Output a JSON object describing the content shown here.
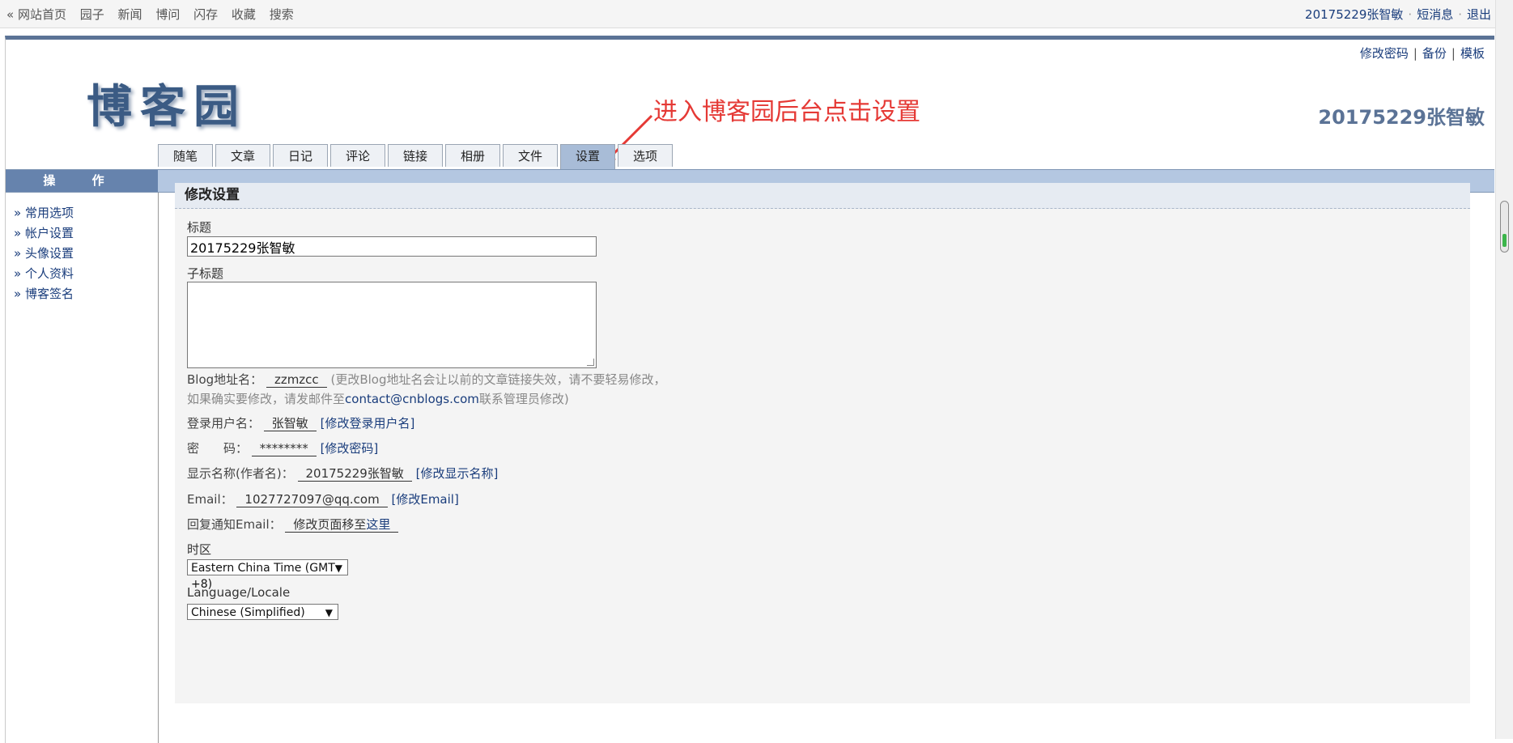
{
  "topnav": {
    "items": [
      "« 网站首页",
      "园子",
      "新闻",
      "博问",
      "闪存",
      "收藏",
      "搜索"
    ],
    "user": "20175229张智敏",
    "messages": "短消息",
    "logout": "退出"
  },
  "header": {
    "links": [
      "修改密码",
      "备份",
      "模板"
    ],
    "logo_text": "博客园",
    "blog_name": "20175229张智敏",
    "annotation": "进入博客园后台点击设置"
  },
  "tabs": [
    {
      "label": "随笔",
      "active": false
    },
    {
      "label": "文章",
      "active": false
    },
    {
      "label": "日记",
      "active": false
    },
    {
      "label": "评论",
      "active": false
    },
    {
      "label": "链接",
      "active": false
    },
    {
      "label": "相册",
      "active": false
    },
    {
      "label": "文件",
      "active": false
    },
    {
      "label": "设置",
      "active": true
    },
    {
      "label": "选项",
      "active": false
    }
  ],
  "sidebar": {
    "title": "操 作",
    "items": [
      "» 常用选项",
      "» 帐户设置",
      "» 头像设置",
      "» 个人资料",
      "» 博客签名"
    ]
  },
  "form": {
    "section_title": "修改设置",
    "title_label": "标题",
    "title_value": "20175229张智敏",
    "subtitle_label": "子标题",
    "blog_address_label": "Blog地址名：",
    "blog_address_value": "zzmzcc",
    "blog_address_note1": "(更改Blog地址名会让以前的文章链接失效，请不要轻易修改，",
    "blog_address_note2a": "如果确实要修改，请发邮件至",
    "blog_address_email": "contact@cnblogs.com",
    "blog_address_note2b": "联系管理员修改)",
    "login_label": "登录用户名：",
    "login_value": "张智敏",
    "login_link": "[修改登录用户名]",
    "password_label": "密　　码：",
    "password_value": "********",
    "password_link": "[修改密码]",
    "display_label": "显示名称(作者名)：",
    "display_value": "20175229张智敏",
    "display_link": "[修改显示名称]",
    "email_label": "Email：",
    "email_value": "1027727097@qq.com",
    "email_link": "[修改Email]",
    "notify_label": "回复通知Email：",
    "notify_prefix": "修改页面移至",
    "notify_link": "这里",
    "timezone_label": "时区",
    "timezone_value": "Eastern China Time (GMT +8)",
    "language_label": "Language/Locale",
    "language_value": "Chinese (Simplified)"
  },
  "colors": {
    "accent_blue": "#6683ad",
    "band_blue": "#b4c7e1",
    "annotation_red": "#e53935",
    "link": "#1a3d7c"
  }
}
